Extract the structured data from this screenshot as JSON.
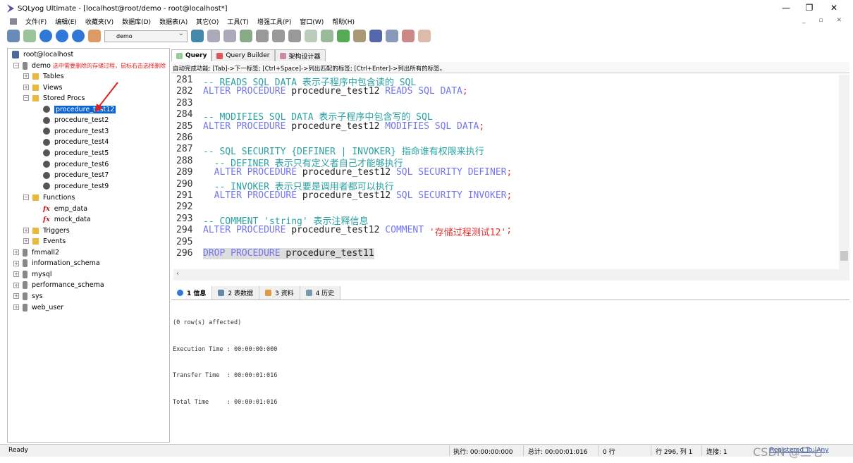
{
  "window": {
    "title": "SQLyog Ultimate - [localhost@root/demo - root@localhost*]"
  },
  "menu": [
    "文件(F)",
    "编辑(E)",
    "收藏夹(V)",
    "数据库(D)",
    "数据表(A)",
    "其它(O)",
    "工具(T)",
    "增强工具(P)",
    "窗口(W)",
    "帮助(H)"
  ],
  "toolbar": {
    "database": "demo"
  },
  "tree": {
    "root": "root@localhost",
    "db": "demo",
    "note": "选中需要删除的存储过程，鼠标右击选择删除",
    "tables": "Tables",
    "views": "Views",
    "procs": "Stored Procs",
    "procedures": [
      "procedure_test12",
      "procedure_test2",
      "procedure_test3",
      "procedure_test4",
      "procedure_test5",
      "procedure_test6",
      "procedure_test7",
      "procedure_test9"
    ],
    "functions_label": "Functions",
    "functions": [
      "emp_data",
      "mock_data"
    ],
    "triggers": "Triggers",
    "events": "Events",
    "databases": [
      "fmmall2",
      "information_schema",
      "mysql",
      "performance_schema",
      "sys",
      "web_user"
    ]
  },
  "tabs": [
    "Query",
    "Query Builder",
    "架构设计器"
  ],
  "hint": "自动完成功能: [Tab]->下一标签; [Ctrl+Space]->列出匹配的标签; [Ctrl+Enter]->列出所有的标签。",
  "code": [
    {
      "n": "281",
      "t": [
        [
          "cm",
          "-- READS SQL DATA 表示子程序中包含读的 SQL"
        ]
      ]
    },
    {
      "n": "282",
      "t": [
        [
          "kw",
          "ALTER PROCEDURE "
        ],
        [
          "id",
          "procedure_test12 "
        ],
        [
          "kw",
          "READS SQL DATA"
        ],
        [
          "pn",
          ";"
        ]
      ]
    },
    {
      "n": "283",
      "t": []
    },
    {
      "n": "284",
      "t": [
        [
          "cm",
          "-- MODIFIES SQL DATA 表示子程序中包含写的 SQL"
        ]
      ]
    },
    {
      "n": "285",
      "t": [
        [
          "kw",
          "ALTER PROCEDURE "
        ],
        [
          "id",
          "procedure_test12 "
        ],
        [
          "kw",
          "MODIFIES SQL DATA"
        ],
        [
          "pn",
          ";"
        ]
      ]
    },
    {
      "n": "286",
      "t": []
    },
    {
      "n": "287",
      "t": [
        [
          "cm",
          "-- SQL SECURITY {DEFINER | INVOKER} 指命谁有权限来执行"
        ]
      ]
    },
    {
      "n": "288",
      "t": [
        [
          "cm",
          "  -- DEFINER 表示只有定义者自己才能够执行"
        ]
      ]
    },
    {
      "n": "289",
      "t": [
        [
          "kw",
          "  ALTER PROCEDURE "
        ],
        [
          "id",
          "procedure_test12 "
        ],
        [
          "kw",
          "SQL SECURITY DEFINER"
        ],
        [
          "pn",
          ";"
        ]
      ]
    },
    {
      "n": "290",
      "t": [
        [
          "cm",
          "  -- INVOKER 表示只要是调用者都可以执行"
        ]
      ]
    },
    {
      "n": "291",
      "t": [
        [
          "kw",
          "  ALTER PROCEDURE "
        ],
        [
          "id",
          "procedure_test12 "
        ],
        [
          "kw",
          "SQL SECURITY INVOKER"
        ],
        [
          "pn",
          ";"
        ]
      ]
    },
    {
      "n": "292",
      "t": []
    },
    {
      "n": "293",
      "t": [
        [
          "cm",
          "-- COMMENT 'string' 表示注释信息"
        ]
      ]
    },
    {
      "n": "294",
      "t": [
        [
          "kw",
          "ALTER PROCEDURE "
        ],
        [
          "id",
          "procedure_test12 "
        ],
        [
          "kw",
          "COMMENT "
        ],
        [
          "st",
          "'存储过程测试12'"
        ],
        [
          "pn",
          ";"
        ]
      ]
    },
    {
      "n": "295",
      "t": []
    },
    {
      "n": "296",
      "t": [
        [
          "kw hl",
          "DROP PROCEDURE "
        ],
        [
          "id hl",
          "procedure_test11"
        ]
      ]
    }
  ],
  "result_tabs": [
    "1 信息",
    "2 表数据",
    "3 资料",
    "4 历史"
  ],
  "results": [
    "(0 row(s) affected)",
    "Execution Time : 00:00:00:000",
    "Transfer Time  : 00:00:01:016",
    "Total Time     : 00:00:01:016"
  ],
  "status": {
    "ready": "Ready",
    "exec": "执行: 00:00:00:000",
    "total": "总计: 00:00:01:016",
    "rows": "0 行",
    "pos": "行 296, 列 1",
    "conn": "连接: 1",
    "reg": "Registered To: Any"
  },
  "watermark": "CSDN @三七"
}
